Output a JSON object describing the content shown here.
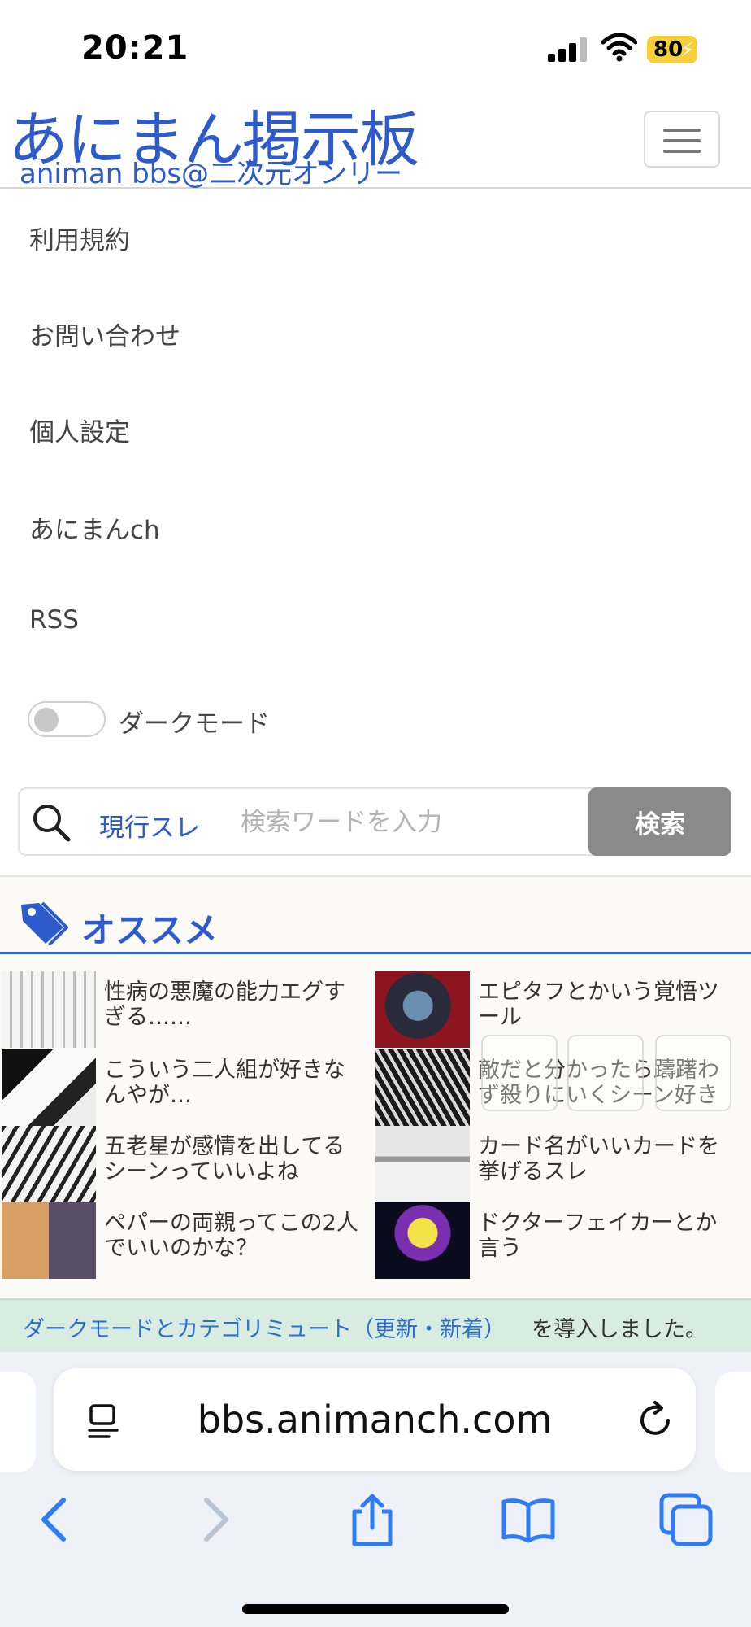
{
  "status_bar": {
    "time": "20:21",
    "battery": "80"
  },
  "header": {
    "logo_main": "あにまん掲示板",
    "logo_sub": "animan bbs@二次元オンリー"
  },
  "menu": {
    "items": [
      "利用規約",
      "お問い合わせ",
      "個人設定",
      "あにまんch",
      "RSS"
    ],
    "dark_mode_label": "ダークモード",
    "dark_mode_on": false
  },
  "search": {
    "scope": "現行スレ",
    "placeholder": "検索ワードを入力",
    "button": "検索"
  },
  "recommend": {
    "title": "オススメ",
    "items": [
      {
        "title": "性病の悪魔の能力エグすぎる……"
      },
      {
        "title": "エピタフとかいう覚悟ツール"
      },
      {
        "title": "こういう二人組が好きなんやが…"
      },
      {
        "title": "敵だと分かったら躊躇わず殺りにいくシーン好き"
      },
      {
        "title": "五老星が感情を出してるシーンっていいよね"
      },
      {
        "title": "カード名がいいカードを挙げるスレ"
      },
      {
        "title": "ペパーの両親ってこの2人でいいのかな？"
      },
      {
        "title": "ドクターフェイカーとか言う"
      }
    ]
  },
  "notice": {
    "link": "ダークモードとカテゴリミュート（更新・新着）",
    "rest": "を導入しました。"
  },
  "browser": {
    "url": "bbs.animanch.com"
  },
  "colors": {
    "brand_blue": "#2d5bcb",
    "search_button": "#8a8a8a",
    "notice_bg": "#d9ece2",
    "ios_blue": "#2f7df6"
  }
}
